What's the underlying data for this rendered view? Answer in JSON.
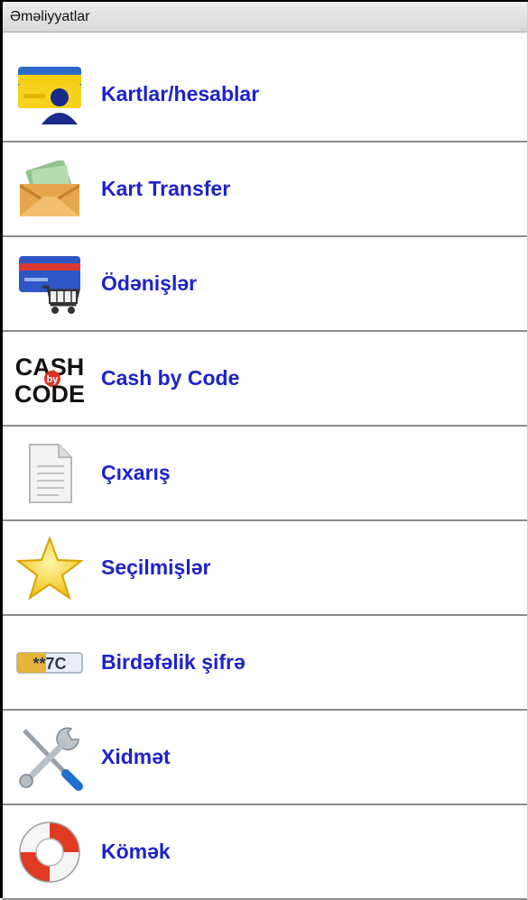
{
  "header": {
    "title": "Əməliyyatlar"
  },
  "menu": {
    "items": [
      {
        "label": "Kartlar/hesablar",
        "icon": "card-user-icon"
      },
      {
        "label": "Kart Transfer",
        "icon": "envelope-money-icon"
      },
      {
        "label": "Ödənişlər",
        "icon": "card-cart-icon"
      },
      {
        "label": "Cash by Code",
        "icon": "cash-by-code-icon",
        "icon_text_top": "CASH",
        "icon_text_mid": "by",
        "icon_text_bottom": "CODE"
      },
      {
        "label": "Çıxarış",
        "icon": "document-icon"
      },
      {
        "label": "Seçilmişlər",
        "icon": "star-icon"
      },
      {
        "label": "Birdəfəlik şifrə",
        "icon": "one-time-password-icon",
        "icon_text": "**7C"
      },
      {
        "label": "Xidmət",
        "icon": "tools-icon"
      },
      {
        "label": "Kömək",
        "icon": "lifebuoy-icon"
      }
    ]
  },
  "colors": {
    "label": "#1d23c8",
    "header_bg": "#e3e3e3",
    "divider": "#8c8c8c"
  }
}
